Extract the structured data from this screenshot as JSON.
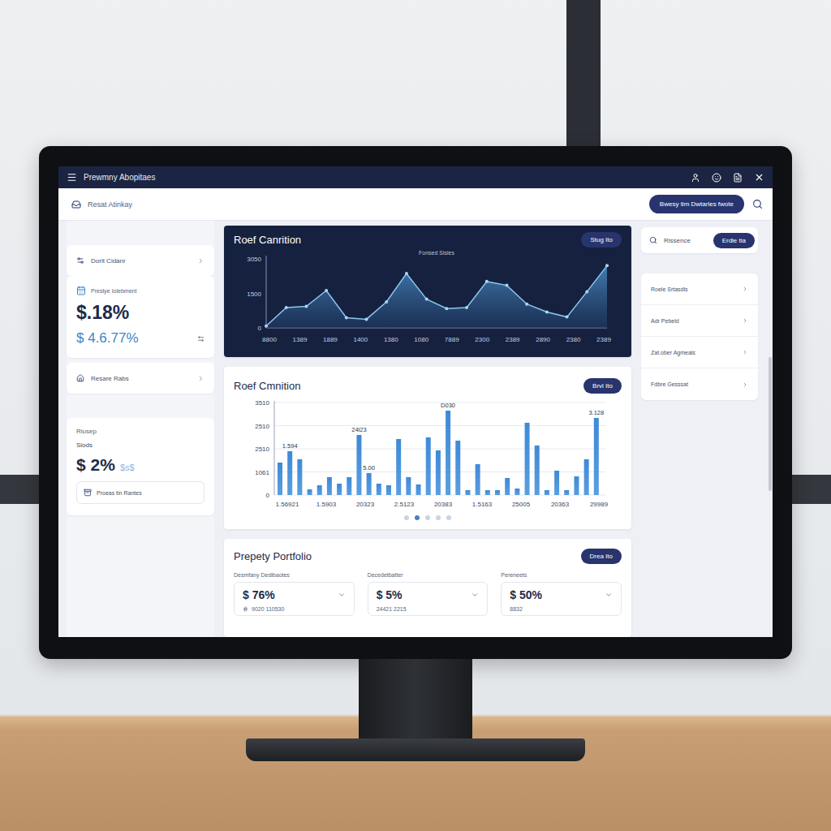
{
  "window": {
    "title": "Prewmny Abopitaes"
  },
  "toolbar": {
    "breadcrumb": "Resat Atinkay",
    "action": "Bwesy tim Dwtarles fwote"
  },
  "sidebar": {
    "top_item": {
      "label": "Dorit Cidanr"
    },
    "metric": {
      "label": "Prestye Iolebment",
      "value": "$.18%",
      "sub_value": "$ 4.6.77%"
    },
    "bottom_item": {
      "label": "Resare Rabs"
    },
    "stats": {
      "caption": "Riusep",
      "label": "Siods",
      "value": "$ 2%",
      "suffix": "$s$",
      "button": "Proeas tin Rantes"
    }
  },
  "line_chart": {
    "title": "Roef Canrition",
    "button": "Stug Ito",
    "subtitle": "Fonsed Sisles",
    "y_ticks": [
      "0",
      "1500",
      "3050"
    ],
    "x_ticks": [
      "8800",
      "1389",
      "1889",
      "1400",
      "1380",
      "1080",
      "7889",
      "2300",
      "2389",
      "2890",
      "2380",
      "2389"
    ],
    "values": [
      80,
      900,
      950,
      1650,
      450,
      380,
      1150,
      2400,
      1270,
      850,
      900,
      2050,
      1880,
      1050,
      700,
      480,
      1600,
      2750
    ]
  },
  "bar_chart": {
    "title": "Roef Cmnition",
    "button": "Brvl Ito",
    "y_ticks": [
      "0",
      "1061",
      "2510",
      "2510",
      "3510"
    ],
    "x_ticks": [
      "1.56921",
      "1.5903",
      "20323",
      "2.5123",
      "20383",
      "1.5163",
      "25005",
      "20363",
      "29989"
    ],
    "values": [
      1232,
      1663,
      1355,
      216,
      370,
      678,
      431,
      678,
      2279,
      832,
      431,
      370,
      2125,
      678,
      400,
      2187,
      1694,
      3203,
      2064,
      185,
      1170,
      185,
      185,
      647,
      246,
      2741,
      1879,
      185,
      924,
      185,
      708,
      1355,
      2926
    ],
    "annotations": [
      {
        "label": "1.594",
        "bar": 1
      },
      {
        "label": "24l23",
        "bar": 8
      },
      {
        "label": "5.00",
        "bar": 9
      },
      {
        "label": "D030",
        "bar": 17
      },
      {
        "label": "3.128",
        "bar": 32
      }
    ],
    "pages": [
      {
        "selected": false
      },
      {
        "selected": true
      },
      {
        "selected": false
      },
      {
        "selected": false
      },
      {
        "selected": false
      }
    ]
  },
  "portfolio": {
    "title": "Prepety Portfolio",
    "button": "Drea Ito",
    "columns": [
      {
        "label": "Desmfany Dedibaotes",
        "value": "$ 76%",
        "detail": "9020 110530"
      },
      {
        "label": "Decedetbatter",
        "value": "$ 5%",
        "detail": "24421 2215"
      },
      {
        "label": "Pereneets",
        "value": "$ 50%",
        "detail": "8832"
      }
    ]
  },
  "search": {
    "placeholder": "Rissence",
    "button": "Erdle tia"
  },
  "side_list": {
    "items": [
      "Roele Srtasdls",
      "Adr Pebeld",
      "Zat.ober Agmeals",
      "Fdbre Gesssat"
    ]
  }
}
